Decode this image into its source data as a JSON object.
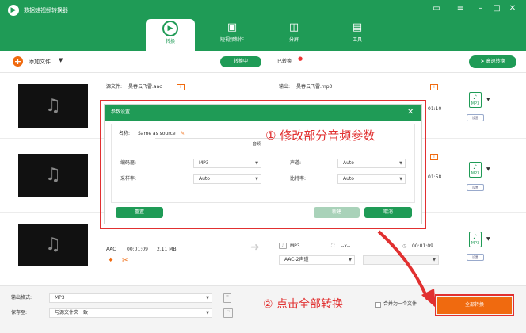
{
  "app": {
    "title": "数据蛙视频转换器"
  },
  "window_controls": [
    "feedback-icon",
    "menu-icon",
    "minimize-icon",
    "maximize-icon",
    "close-icon"
  ],
  "nav": [
    {
      "label": "转换",
      "icon": "convert-icon",
      "active": true
    },
    {
      "label": "短视频制作",
      "icon": "short-video-icon"
    },
    {
      "label": "分屏",
      "icon": "split-screen-icon"
    },
    {
      "label": "工具",
      "icon": "toolbox-icon"
    }
  ],
  "toolbar": {
    "add_file": "添加文件",
    "converting": "转换中",
    "converted": "已转换",
    "fast_convert": "高速转换"
  },
  "rows": [
    {
      "source_label": "源文件:",
      "source_name": "昊春云飞雷.aac",
      "output_label": "输出:",
      "output_name": "昊春云飞雷.mp3",
      "time": "01:10",
      "format": "MP3",
      "settings": "设置"
    },
    {
      "time": "01:58",
      "format": "MP3",
      "settings": "设置"
    },
    {
      "codec": "AAC",
      "duration": "00:01:09",
      "size": "2.11 MB",
      "out_format": "MP3",
      "out_res": "--x--",
      "out_time": "00:01:09",
      "audio_track": "AAC-2声道",
      "format": "MP3",
      "settings": "设置"
    }
  ],
  "modal": {
    "title": "参数设置",
    "name_label": "名称:",
    "name_value": "Same as source",
    "section_audio": "音频",
    "encoder_label": "编码器:",
    "encoder_value": "MP3",
    "channel_label": "声道:",
    "channel_value": "Auto",
    "samplerate_label": "采样率:",
    "samplerate_value": "Auto",
    "bitrate_label": "比特率:",
    "bitrate_value": "Auto",
    "reset": "重置",
    "save": "新建",
    "cancel": "取消"
  },
  "annotations": {
    "step1": "① 修改部分音频参数",
    "step2": "② 点击全部转换"
  },
  "bottom": {
    "format_label": "输出格式:",
    "format_value": "MP3",
    "save_label": "保存至:",
    "save_value": "与源文件夹一致",
    "merge_label": "合并为一个文件",
    "convert_all": "全部转换"
  },
  "colors": {
    "brand": "#1f9b56",
    "accent": "#f06a0f",
    "annotation": "#e13030"
  }
}
